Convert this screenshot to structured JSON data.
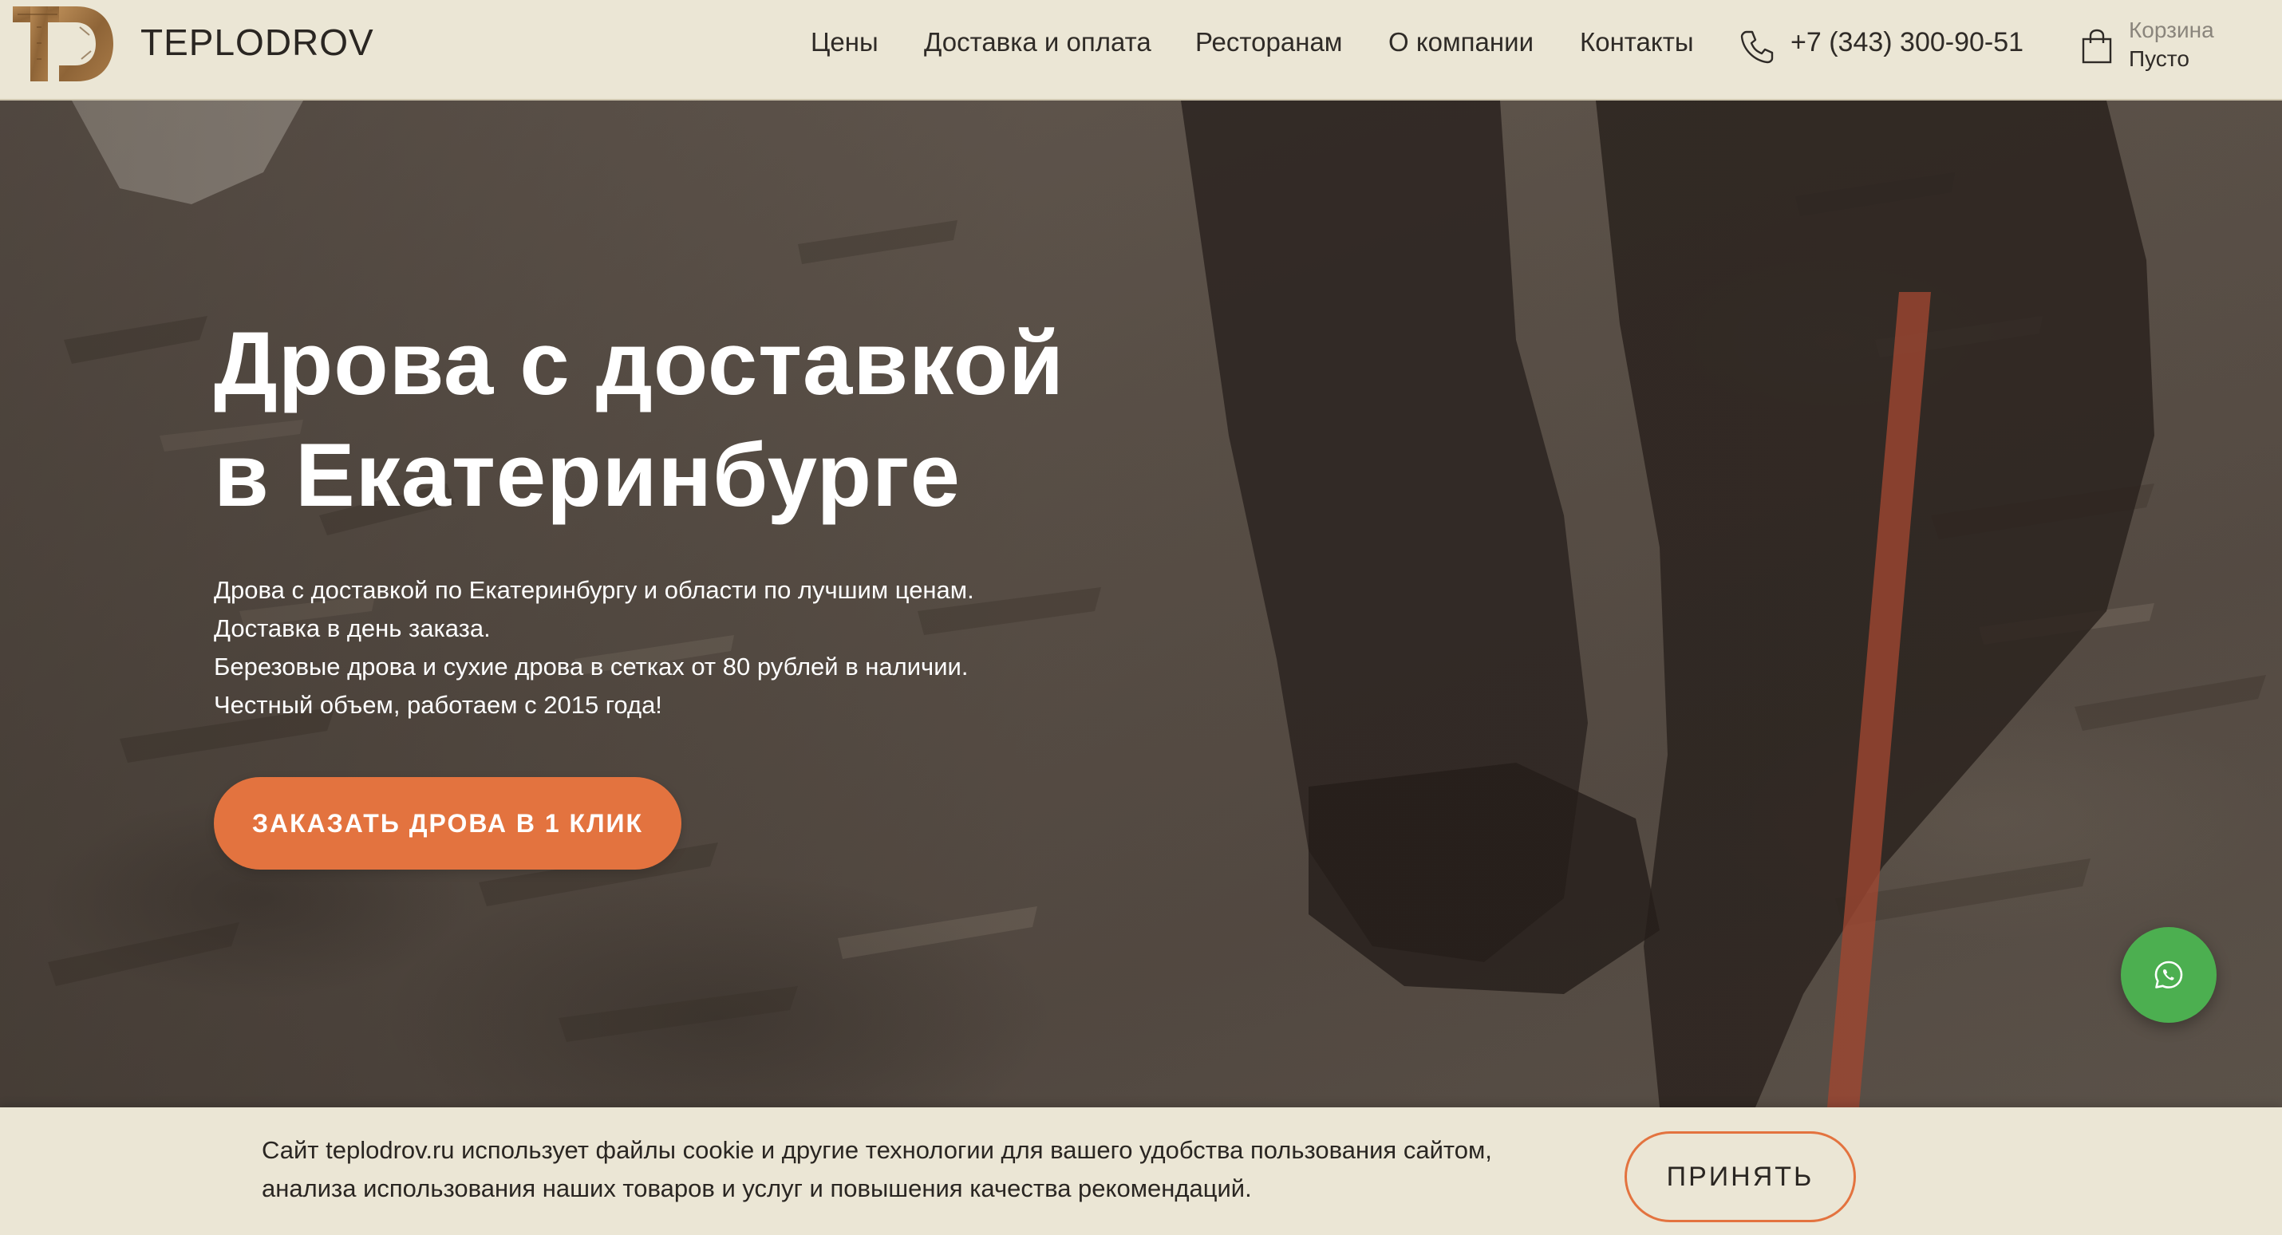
{
  "brand": {
    "logo_name": "TEPLODROV"
  },
  "nav": {
    "items": [
      {
        "label": "Цены"
      },
      {
        "label": "Доставка и оплата"
      },
      {
        "label": "Ресторанам"
      },
      {
        "label": "О компании"
      },
      {
        "label": "Контакты"
      }
    ],
    "phone": "+7 (343) 300-90-51",
    "cart": {
      "title": "Корзина",
      "status": "Пусто"
    }
  },
  "hero": {
    "title_lines": [
      "Дрова с доставкой",
      "в Екатеринбурге"
    ],
    "description_lines": [
      "Дрова с доставкой по Екатеринбургу и области по лучшим ценам.",
      "Доставка в день заказа.",
      "Березовые дрова и сухие дрова в сетках от 80 рублей в наличии.",
      "Честный объем, работаем с 2015 года!"
    ],
    "cta_label": "ЗАКАЗАТЬ ДРОВА В 1 КЛИК"
  },
  "cookie": {
    "text_lines": [
      "Сайт teplodrov.ru использует файлы cookie и другие технологии для вашего удобства пользования сайтом,",
      "анализа использования наших товаров и услуг и повышения качества рекомендаций."
    ],
    "accept_label": "ПРИНЯТЬ"
  },
  "icons": {
    "phone": "phone-icon",
    "cart": "shopping-bag-icon",
    "whatsapp": "whatsapp-icon",
    "logo": "td-monogram-logo"
  },
  "colors": {
    "header_bg": "#ebe6d5",
    "accent": "#e3733f",
    "whatsapp": "#4caf50",
    "text_dark": "#2f2b27"
  }
}
